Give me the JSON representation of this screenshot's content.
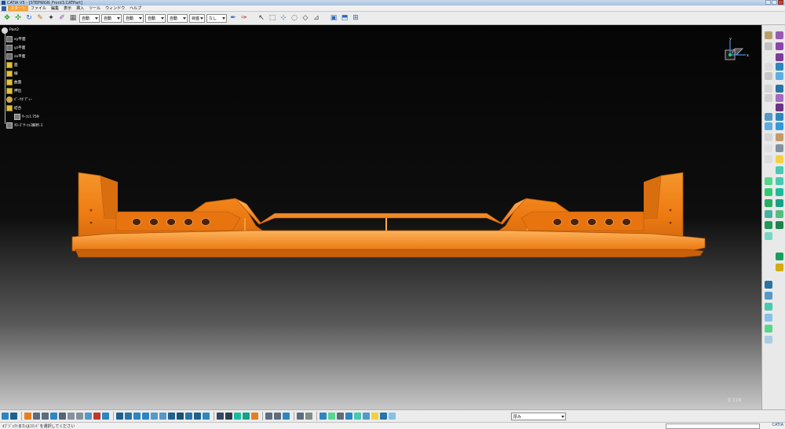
{
  "window": {
    "title": "CATIA V5 - [STEPWGN_Front3.CATPart]"
  },
  "menu": {
    "items": [
      "スタート",
      "ファイル",
      "編集",
      "表示",
      "挿入",
      "ツール",
      "ウィンドウ",
      "ヘルプ"
    ]
  },
  "toolbar": {
    "combos": [
      {
        "value": "自動"
      },
      {
        "value": "自動"
      },
      {
        "value": "自動"
      },
      {
        "value": "自動"
      },
      {
        "value": "自動"
      },
      {
        "value": "目盛"
      },
      {
        "value": "なし"
      }
    ]
  },
  "tree": {
    "root": "Part2",
    "items": [
      {
        "label": "xy平面",
        "icon": "plane-icon"
      },
      {
        "label": "yz平面",
        "icon": "plane-icon"
      },
      {
        "label": "zx平面",
        "icon": "plane-icon"
      },
      {
        "label": "面",
        "icon": "folder-icon"
      },
      {
        "label": "線",
        "icon": "folder-icon"
      },
      {
        "label": "曲面",
        "icon": "folder-icon"
      },
      {
        "label": "押出",
        "icon": "folder-icon"
      },
      {
        "label": "ﾊﾟｰﾂﾎﾞﾃﾞｨｰ",
        "icon": "gear-icon"
      },
      {
        "label": "結合",
        "icon": "folder-icon"
      },
      {
        "label": "ｻｰﾌｪｽ.759",
        "icon": "geometry-icon"
      },
      {
        "label": "ｸﾛｰｽﾞｻｰﾌｪｽ解析.1",
        "icon": "analysis-icon"
      }
    ]
  },
  "compass": {
    "x": "x",
    "y": "y",
    "z": "z"
  },
  "viewport": {
    "scale_readout": "0.318",
    "part_color": "#f07d14"
  },
  "bottom_toolbar": {
    "view_mode": "厚み"
  },
  "status": {
    "message": "ｵﾌﾞｼﾞｪｸﾄまたはｺﾏﾝﾄﾞを選択してください",
    "logo": "CATIA"
  },
  "colors": {
    "accent": "#f6a23c",
    "part": "#f07d14"
  }
}
